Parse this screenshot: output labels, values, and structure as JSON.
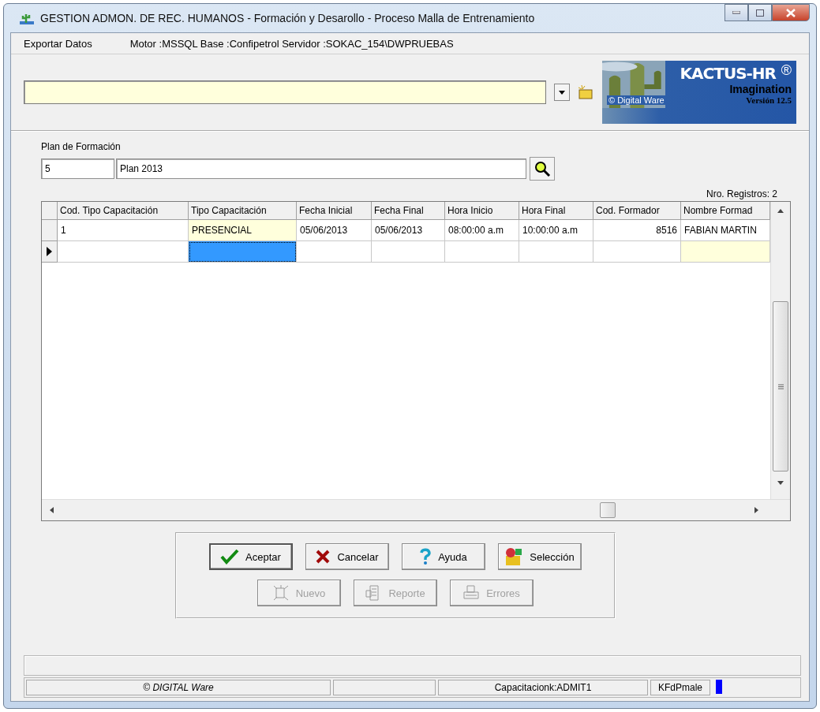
{
  "window": {
    "title": "GESTION ADMON. DE REC. HUMANOS - Formación y Desarollo - Proceso Malla de Entrenamiento"
  },
  "menu": {
    "items": [
      {
        "label": "Exportar Datos"
      }
    ],
    "connection_info": "Motor :MSSQL  Base :Confipetrol  Servidor :SOKAC_154\\DWPRUEBAS"
  },
  "logo": {
    "name": "KACTUS-HR",
    "mark": "®",
    "tagline": "Imagination",
    "maker": "© Digital Ware",
    "version": "Versión 12.5"
  },
  "plan": {
    "label": "Plan de Formación",
    "code": "5",
    "name": "Plan 2013"
  },
  "record_count": "Nro. Registros: 2",
  "table": {
    "columns": [
      {
        "label": "Cod. Tipo Capacitación",
        "kind": "text"
      },
      {
        "label": "Tipo Capacitación",
        "kind": "text"
      },
      {
        "label": "Fecha Inicial",
        "kind": "text"
      },
      {
        "label": "Fecha Final",
        "kind": "text"
      },
      {
        "label": "Hora Inicio",
        "kind": "text"
      },
      {
        "label": "Hora Final",
        "kind": "text"
      },
      {
        "label": "Cod. Formador",
        "kind": "number"
      },
      {
        "label": "Nombre Formad",
        "kind": "text"
      }
    ],
    "rows": [
      {
        "current": false,
        "cells": [
          {
            "text": "1",
            "highlighted": false,
            "focused": false
          },
          {
            "text": "PRESENCIAL",
            "highlighted": true,
            "focused": false
          },
          {
            "text": "05/06/2013",
            "highlighted": false,
            "focused": false
          },
          {
            "text": "05/06/2013",
            "highlighted": false,
            "focused": false
          },
          {
            "text": "08:00:00 a.m",
            "highlighted": false,
            "focused": false
          },
          {
            "text": "10:00:00 a.m",
            "highlighted": false,
            "focused": false
          },
          {
            "text": "8516",
            "highlighted": false,
            "focused": false
          },
          {
            "text": "FABIAN MARTIN",
            "highlighted": false,
            "focused": false
          }
        ]
      },
      {
        "current": true,
        "cells": [
          {
            "highlighted": false,
            "focused": false
          },
          {
            "highlighted": false,
            "focused": true
          },
          {
            "highlighted": false,
            "focused": false
          },
          {
            "highlighted": false,
            "focused": false
          },
          {
            "highlighted": false,
            "focused": false
          },
          {
            "highlighted": false,
            "focused": false
          },
          {
            "highlighted": false,
            "focused": false
          },
          {
            "highlighted": true,
            "focused": false
          }
        ]
      }
    ]
  },
  "buttons": [
    [
      {
        "label": "Aceptar",
        "kind": "check",
        "disabled": false
      },
      {
        "label": "Cancelar",
        "kind": "cross",
        "disabled": false
      },
      {
        "label": "Ayuda",
        "kind": "help",
        "disabled": false
      },
      {
        "label": "Selección",
        "kind": "query",
        "disabled": false
      }
    ],
    [
      {
        "label": "Nuevo",
        "kind": "new",
        "disabled": true
      },
      {
        "label": "Reporte",
        "kind": "report",
        "disabled": true
      },
      {
        "label": "Errores",
        "kind": "print",
        "disabled": true
      }
    ]
  ],
  "status_bar": {
    "panes": [
      {
        "kind": "text",
        "text": "© DIGITAL Ware",
        "italic": true
      },
      {
        "kind": "blank"
      },
      {
        "kind": "text",
        "text": "Capacitacionk:ADMIT1",
        "italic": false
      },
      {
        "kind": "text",
        "text": "KFdPmale",
        "italic": false
      },
      {
        "kind": "indicator"
      }
    ]
  }
}
